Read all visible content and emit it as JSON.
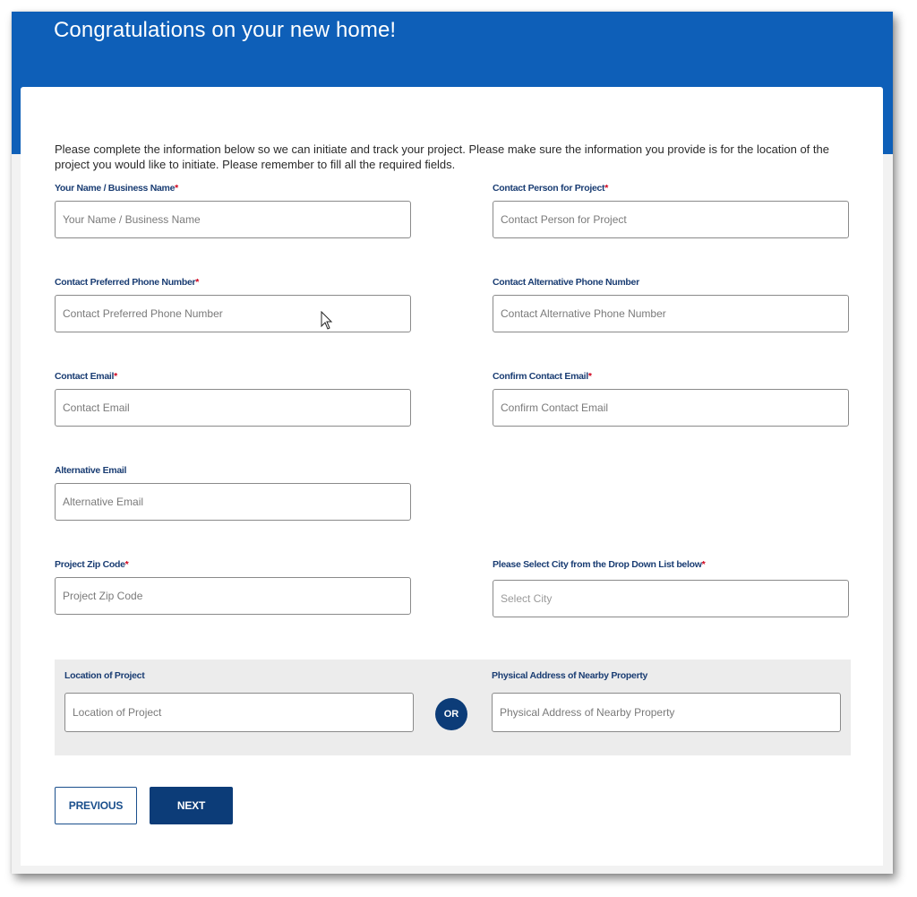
{
  "header": {
    "title": "Congratulations on your new home!"
  },
  "intro": "Please complete the information below so we can initiate and track your project. Please make sure the information you provide is for the location of the project you would like to initiate. Please remember to fill all the required fields.",
  "required_marker": "*",
  "fields": {
    "name": {
      "label": "Your Name / Business Name",
      "required": true,
      "placeholder": "Your Name / Business Name",
      "value": ""
    },
    "contact_person": {
      "label": "Contact Person for Project",
      "required": true,
      "placeholder": "Contact Person for Project",
      "value": ""
    },
    "preferred_phone": {
      "label": "Contact Preferred Phone Number",
      "required": true,
      "placeholder": "Contact Preferred Phone Number",
      "value": ""
    },
    "alternative_phone": {
      "label": "Contact Alternative Phone Number",
      "required": false,
      "placeholder": "Contact Alternative Phone Number",
      "value": ""
    },
    "email": {
      "label": "Contact Email",
      "required": true,
      "placeholder": "Contact Email",
      "value": ""
    },
    "confirm_email": {
      "label": "Confirm Contact Email",
      "required": true,
      "placeholder": "Confirm Contact Email",
      "value": ""
    },
    "alternative_email": {
      "label": "Alternative Email",
      "required": false,
      "placeholder": "Alternative Email",
      "value": ""
    },
    "zip": {
      "label": "Project Zip Code",
      "required": true,
      "placeholder": "Project Zip Code",
      "value": ""
    },
    "city": {
      "label": "Please Select City from the Drop Down List below",
      "required": true,
      "placeholder": "Select City",
      "value": ""
    }
  },
  "location_panel": {
    "location": {
      "label": "Location of Project",
      "placeholder": "Location of Project",
      "value": ""
    },
    "or_label": "OR",
    "nearby_address": {
      "label": "Physical Address of Nearby Property",
      "placeholder": "Physical Address of Nearby Property",
      "value": ""
    }
  },
  "buttons": {
    "previous": "PREVIOUS",
    "next": "NEXT"
  },
  "colors": {
    "header_blue": "#0e5fb8",
    "label_navy": "#1a3d73",
    "button_navy": "#0c3c78",
    "required_red": "#d0021b"
  }
}
